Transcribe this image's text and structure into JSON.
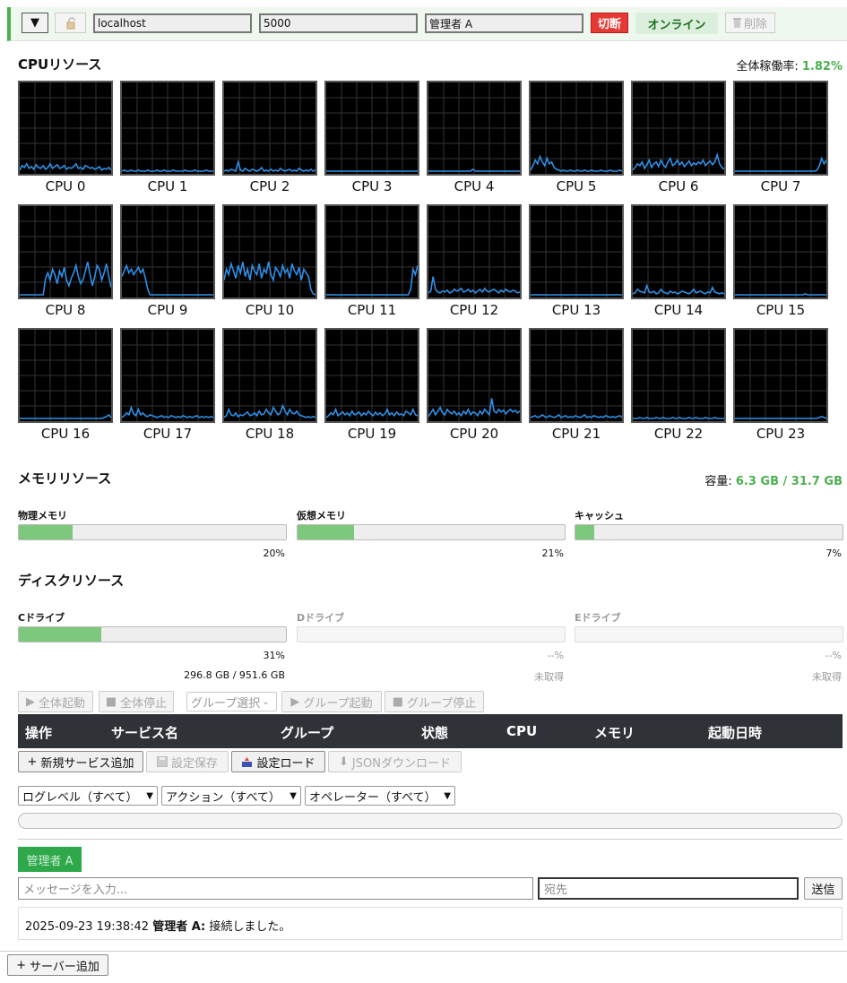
{
  "toolbar": {
    "toggle": "▼",
    "host": "localhost",
    "port": "5000",
    "operator": "管理者 A",
    "disconnect": "切断",
    "status": "オンライン",
    "delete": "削除"
  },
  "cpu": {
    "title": "CPUリソース",
    "overall_label": "全体稼働率:",
    "overall_value": "1.82%",
    "line_color": "#2e8fe6",
    "cores": [
      {
        "label": "CPU 0",
        "values": [
          3,
          8,
          6,
          10,
          5,
          7,
          4,
          9,
          6,
          5,
          8,
          4,
          6,
          10,
          5,
          7,
          9,
          5,
          6,
          8,
          4,
          6,
          5,
          7,
          10,
          5,
          6,
          4,
          8,
          7,
          5,
          6,
          4,
          5,
          7,
          3,
          5,
          4,
          6,
          3
        ]
      },
      {
        "label": "CPU 1",
        "values": [
          2,
          3,
          2,
          2,
          3,
          2,
          2,
          3,
          2,
          2,
          2,
          3,
          2,
          2,
          2,
          3,
          2,
          2,
          3,
          2,
          2,
          2,
          3,
          2,
          2,
          2,
          2,
          3,
          2,
          2,
          2,
          3,
          2,
          2,
          2,
          2,
          3,
          2,
          2,
          2
        ]
      },
      {
        "label": "CPU 2",
        "values": [
          2,
          3,
          2,
          4,
          3,
          2,
          12,
          3,
          2,
          5,
          3,
          2,
          4,
          3,
          2,
          3,
          6,
          2,
          3,
          2,
          4,
          2,
          3,
          2,
          5,
          3,
          2,
          3,
          4,
          2,
          3,
          2,
          5,
          3,
          2,
          3,
          2,
          4,
          2,
          3
        ]
      },
      {
        "label": "CPU 3",
        "values": [
          2,
          2,
          2,
          2,
          2,
          2,
          2,
          2,
          2,
          2,
          2,
          2,
          2,
          2,
          2,
          2,
          2,
          2,
          2,
          2,
          2,
          2,
          2,
          2,
          2,
          2,
          2,
          2,
          2,
          2,
          2,
          2,
          2,
          2,
          2,
          2,
          2,
          2,
          2,
          2
        ]
      },
      {
        "label": "CPU 4",
        "values": [
          2,
          2,
          2,
          2,
          2,
          2,
          2,
          2,
          2,
          2,
          2,
          2,
          2,
          2,
          2,
          2,
          2,
          2,
          2,
          4,
          2,
          2,
          2,
          2,
          2,
          2,
          2,
          2,
          2,
          2,
          2,
          2,
          2,
          2,
          2,
          2,
          2,
          2,
          2,
          2
        ]
      },
      {
        "label": "CPU 5",
        "values": [
          3,
          8,
          14,
          10,
          18,
          12,
          8,
          16,
          10,
          12,
          6,
          4,
          3,
          2,
          3,
          2,
          2,
          3,
          2,
          2,
          3,
          2,
          2,
          3,
          2,
          2,
          3,
          2,
          2,
          2,
          3,
          2,
          2,
          2,
          3,
          2,
          2,
          2,
          3,
          2
        ]
      },
      {
        "label": "CPU 6",
        "values": [
          3,
          6,
          10,
          8,
          12,
          5,
          9,
          14,
          6,
          10,
          12,
          7,
          14,
          9,
          6,
          12,
          16,
          8,
          10,
          14,
          9,
          12,
          7,
          10,
          13,
          8,
          11,
          9,
          12,
          10,
          14,
          8,
          11,
          13,
          9,
          12,
          20,
          10,
          6,
          4
        ]
      },
      {
        "label": "CPU 7",
        "values": [
          2,
          2,
          2,
          2,
          2,
          2,
          2,
          2,
          2,
          2,
          2,
          2,
          2,
          2,
          2,
          2,
          2,
          2,
          2,
          2,
          2,
          2,
          2,
          2,
          2,
          2,
          2,
          2,
          2,
          2,
          2,
          2,
          2,
          2,
          2,
          3,
          8,
          16,
          10,
          14
        ]
      },
      {
        "label": "CPU 8",
        "values": [
          2,
          2,
          2,
          2,
          2,
          2,
          2,
          2,
          2,
          2,
          2,
          20,
          26,
          18,
          30,
          24,
          14,
          28,
          22,
          32,
          18,
          12,
          20,
          26,
          34,
          22,
          14,
          18,
          28,
          38,
          24,
          12,
          22,
          34,
          30,
          18,
          26,
          36,
          22,
          10
        ]
      },
      {
        "label": "CPU 9",
        "values": [
          22,
          28,
          34,
          26,
          30,
          24,
          28,
          32,
          26,
          30,
          20,
          8,
          2,
          2,
          2,
          2,
          2,
          2,
          2,
          2,
          2,
          2,
          2,
          2,
          2,
          2,
          2,
          2,
          2,
          2,
          2,
          2,
          2,
          2,
          2,
          2,
          2,
          2,
          2,
          2
        ]
      },
      {
        "label": "CPU 10",
        "values": [
          18,
          30,
          24,
          36,
          28,
          20,
          34,
          26,
          38,
          22,
          30,
          18,
          34,
          28,
          24,
          36,
          20,
          30,
          26,
          38,
          24,
          18,
          32,
          28,
          22,
          34,
          26,
          30,
          20,
          36,
          28,
          24,
          32,
          18,
          30,
          26,
          22,
          8,
          3,
          2
        ]
      },
      {
        "label": "CPU 11",
        "values": [
          2,
          2,
          2,
          2,
          2,
          2,
          2,
          2,
          2,
          2,
          2,
          2,
          2,
          2,
          2,
          2,
          2,
          2,
          2,
          2,
          2,
          2,
          2,
          2,
          2,
          2,
          2,
          2,
          2,
          2,
          2,
          2,
          2,
          2,
          2,
          2,
          8,
          30,
          24,
          34
        ]
      },
      {
        "label": "CPU 12",
        "values": [
          4,
          6,
          22,
          8,
          5,
          4,
          6,
          5,
          7,
          4,
          5,
          8,
          6,
          7,
          9,
          5,
          6,
          8,
          5,
          7,
          4,
          6,
          8,
          5,
          9,
          6,
          5,
          7,
          8,
          6,
          4,
          7,
          5,
          8,
          6,
          5,
          7,
          6,
          4,
          5
        ]
      },
      {
        "label": "CPU 13",
        "values": [
          2,
          2,
          2,
          2,
          2,
          2,
          2,
          2,
          2,
          2,
          2,
          2,
          2,
          2,
          2,
          2,
          2,
          2,
          2,
          2,
          2,
          2,
          2,
          2,
          2,
          2,
          2,
          2,
          2,
          2,
          2,
          2,
          2,
          2,
          2,
          2,
          2,
          2,
          2,
          2
        ]
      },
      {
        "label": "CPU 14",
        "values": [
          3,
          4,
          8,
          6,
          5,
          4,
          12,
          5,
          4,
          6,
          3,
          4,
          8,
          5,
          4,
          3,
          6,
          4,
          5,
          3,
          4,
          6,
          5,
          4,
          3,
          5,
          8,
          4,
          5,
          6,
          4,
          3,
          5,
          4,
          10,
          5,
          4,
          3,
          4,
          3
        ]
      },
      {
        "label": "CPU 15",
        "values": [
          2,
          2,
          2,
          2,
          2,
          2,
          2,
          2,
          2,
          2,
          2,
          2,
          2,
          2,
          2,
          2,
          2,
          2,
          2,
          2,
          2,
          2,
          2,
          2,
          2,
          2,
          2,
          2,
          2,
          2,
          3,
          2,
          2,
          2,
          2,
          2,
          2,
          2,
          2,
          2
        ]
      },
      {
        "label": "CPU 16",
        "values": [
          2,
          2,
          2,
          2,
          2,
          2,
          2,
          2,
          2,
          2,
          2,
          2,
          2,
          2,
          2,
          2,
          2,
          2,
          2,
          2,
          2,
          2,
          2,
          2,
          2,
          2,
          2,
          2,
          2,
          2,
          2,
          2,
          2,
          2,
          2,
          2,
          3,
          4,
          6,
          3
        ]
      },
      {
        "label": "CPU 17",
        "values": [
          3,
          5,
          8,
          6,
          14,
          7,
          5,
          12,
          6,
          8,
          5,
          4,
          6,
          5,
          4,
          3,
          4,
          5,
          3,
          4,
          3,
          5,
          4,
          3,
          4,
          3,
          5,
          4,
          3,
          4,
          3,
          4,
          5,
          3,
          4,
          3,
          4,
          3,
          4,
          3
        ]
      },
      {
        "label": "CPU 18",
        "values": [
          3,
          5,
          12,
          6,
          5,
          8,
          4,
          6,
          5,
          7,
          9,
          5,
          6,
          8,
          5,
          10,
          6,
          7,
          12,
          8,
          6,
          14,
          10,
          6,
          8,
          16,
          10,
          6,
          12,
          8,
          7,
          10,
          6,
          5,
          4,
          3,
          4,
          3,
          4,
          3
        ]
      },
      {
        "label": "CPU 19",
        "values": [
          3,
          5,
          8,
          6,
          12,
          5,
          7,
          9,
          6,
          8,
          5,
          10,
          6,
          7,
          9,
          5,
          8,
          6,
          10,
          7,
          5,
          9,
          6,
          8,
          5,
          7,
          12,
          6,
          8,
          5,
          9,
          6,
          7,
          5,
          10,
          8,
          6,
          12,
          6,
          5
        ]
      },
      {
        "label": "CPU 20",
        "values": [
          4,
          8,
          12,
          6,
          10,
          14,
          8,
          6,
          12,
          9,
          7,
          10,
          6,
          8,
          5,
          10,
          7,
          12,
          6,
          9,
          8,
          5,
          10,
          7,
          12,
          9,
          6,
          24,
          10,
          8,
          12,
          9,
          11,
          7,
          10,
          12,
          9,
          11,
          8,
          10
        ]
      },
      {
        "label": "CPU 21",
        "values": [
          3,
          4,
          5,
          3,
          4,
          6,
          4,
          3,
          5,
          4,
          3,
          4,
          6,
          3,
          4,
          5,
          3,
          4,
          3,
          5,
          4,
          3,
          4,
          6,
          3,
          4,
          3,
          5,
          4,
          3,
          4,
          3,
          5,
          4,
          3,
          4,
          3,
          4,
          5,
          3
        ]
      },
      {
        "label": "CPU 22",
        "values": [
          2,
          2,
          2,
          3,
          2,
          2,
          3,
          2,
          2,
          2,
          3,
          2,
          2,
          3,
          2,
          2,
          2,
          3,
          2,
          2,
          3,
          2,
          2,
          2,
          3,
          2,
          2,
          3,
          2,
          2,
          2,
          3,
          2,
          2,
          2,
          3,
          2,
          2,
          2,
          2
        ]
      },
      {
        "label": "CPU 23",
        "values": [
          2,
          2,
          2,
          2,
          2,
          2,
          2,
          2,
          2,
          2,
          2,
          2,
          2,
          2,
          2,
          2,
          2,
          2,
          2,
          2,
          2,
          2,
          2,
          2,
          2,
          2,
          2,
          2,
          2,
          2,
          2,
          2,
          2,
          2,
          2,
          2,
          3,
          4,
          3,
          2
        ]
      }
    ]
  },
  "memory": {
    "title": "メモリリソース",
    "capacity_label": "容量:",
    "capacity_value": "6.3 GB / 31.7 GB",
    "items": [
      {
        "label": "物理メモリ",
        "pct_text": "20%",
        "pct": 20
      },
      {
        "label": "仮想メモリ",
        "pct_text": "21%",
        "pct": 21
      },
      {
        "label": "キャッシュ",
        "pct_text": "7%",
        "pct": 7
      }
    ]
  },
  "disk": {
    "title": "ディスクリソース",
    "items": [
      {
        "label": "Cドライブ",
        "pct_text": "31%",
        "pct": 31,
        "size": "296.8 GB / 951.6 GB"
      },
      {
        "label": "Dドライブ",
        "pct_text": "--%",
        "pct": 0,
        "size": "未取得"
      },
      {
        "label": "Eドライブ",
        "pct_text": "--%",
        "pct": 0,
        "size": "未取得"
      }
    ]
  },
  "controls": {
    "start_all": "全体起動",
    "stop_all": "全体停止",
    "group_select": "グループ選択",
    "group_start": "グループ起動",
    "group_stop": "グループ停止"
  },
  "table": {
    "headers": [
      "操作",
      "サービス名",
      "グループ",
      "状態",
      "CPU",
      "メモリ",
      "起動日時"
    ]
  },
  "actions": {
    "add_service": "新規サービス追加",
    "save_config": "設定保存",
    "load_config": "設定ロード",
    "json_download": "JSONダウンロード"
  },
  "filters": {
    "log_level": "ログレベル（すべて）",
    "action": "アクション（すべて）",
    "operator": "オペレーター（すべて）"
  },
  "chat": {
    "user_tab": "管理者 A",
    "message_placeholder": "メッセージを入力...",
    "recipient_placeholder": "宛先",
    "send": "送信",
    "log_time": "2025-09-23 19:38:42",
    "log_user": "管理者 A:",
    "log_text": "接続しました。"
  },
  "footer": {
    "add_server": "サーバー追加"
  }
}
